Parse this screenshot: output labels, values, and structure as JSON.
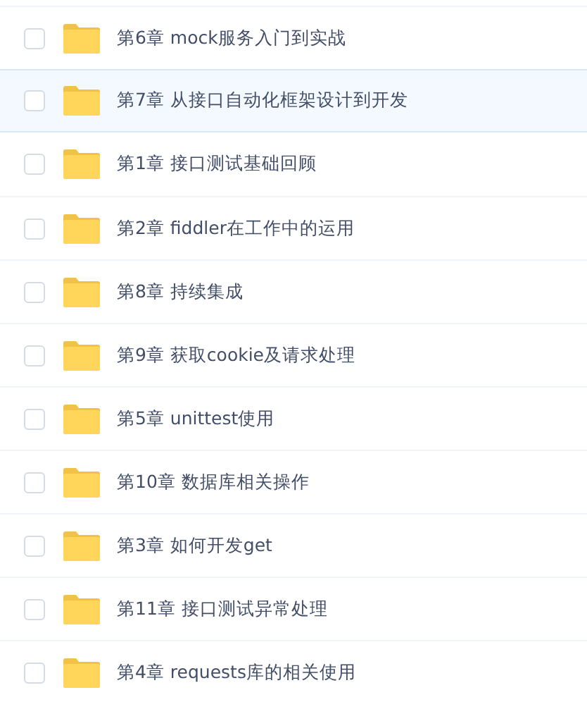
{
  "folders": [
    {
      "name": "第6章 mock服务入门到实战",
      "checked": false,
      "highlighted": false
    },
    {
      "name": "第7章 从接口自动化框架设计到开发",
      "checked": false,
      "highlighted": true
    },
    {
      "name": "第1章 接口测试基础回顾",
      "checked": false,
      "highlighted": false
    },
    {
      "name": "第2章 fiddler在工作中的运用",
      "checked": false,
      "highlighted": false
    },
    {
      "name": "第8章 持续集成",
      "checked": false,
      "highlighted": false
    },
    {
      "name": "第9章 获取cookie及请求处理",
      "checked": false,
      "highlighted": false
    },
    {
      "name": "第5章 unittest使用",
      "checked": false,
      "highlighted": false
    },
    {
      "name": "第10章 数据库相关操作",
      "checked": false,
      "highlighted": false
    },
    {
      "name": "第3章 如何开发get",
      "checked": false,
      "highlighted": false
    },
    {
      "name": "第11章 接口测试异常处理",
      "checked": false,
      "highlighted": false
    },
    {
      "name": "第4章 requests库的相关使用",
      "checked": false,
      "highlighted": false
    }
  ]
}
